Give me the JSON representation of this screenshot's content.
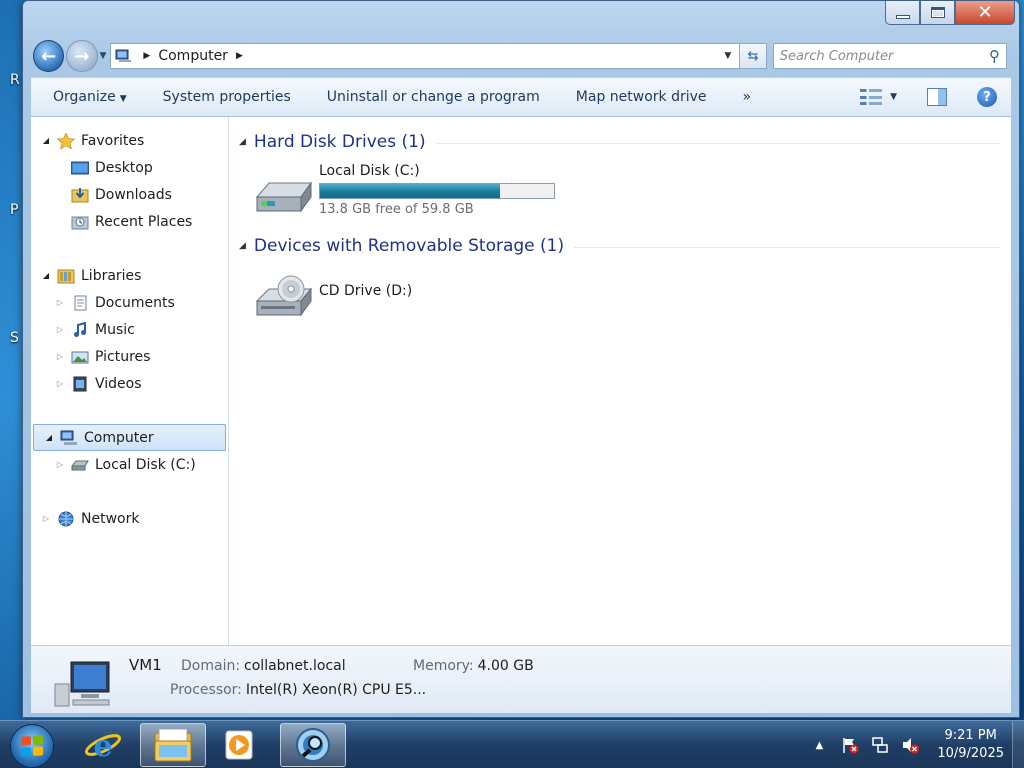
{
  "desktop": {
    "fragments": [
      "R",
      "P",
      "S"
    ]
  },
  "window": {
    "caption": {
      "minimize": "minimize",
      "maximize": "maximize",
      "close": "✕"
    }
  },
  "address": {
    "segment": "Computer",
    "search_placeholder": "Search Computer"
  },
  "commandbar": {
    "items": [
      "Organize",
      "System properties",
      "Uninstall or change a program",
      "Map network drive"
    ],
    "more": "»"
  },
  "navpane": {
    "favorites": "Favorites",
    "desktop": "Desktop",
    "downloads": "Downloads",
    "recent_places": "Recent Places",
    "libraries": "Libraries",
    "documents": "Documents",
    "music": "Music",
    "pictures": "Pictures",
    "videos": "Videos",
    "computer": "Computer",
    "local_disk": "Local Disk (C:)",
    "network": "Network"
  },
  "content": {
    "group_hdd": "Hard Disk Drives (1)",
    "group_removable": "Devices with Removable Storage (1)",
    "drive_c": {
      "name": "Local Disk (C:)",
      "free_text": "13.8 GB free of 59.8 GB",
      "used_fraction": 0.769
    },
    "drive_d": {
      "name": "CD Drive (D:)"
    }
  },
  "details": {
    "computer_name": "VM1",
    "domain_label": "Domain:",
    "domain_value": "collabnet.local",
    "memory_label": "Memory:",
    "memory_value": "4.00 GB",
    "processor_label": "Processor:",
    "processor_value": "Intel(R) Xeon(R) CPU E5..."
  },
  "taskbar": {
    "time": "9:21 PM",
    "date": "10/9/2025"
  },
  "colors": {
    "header_blue": "#1e3287",
    "bar_fill": "#1d7d9d"
  }
}
